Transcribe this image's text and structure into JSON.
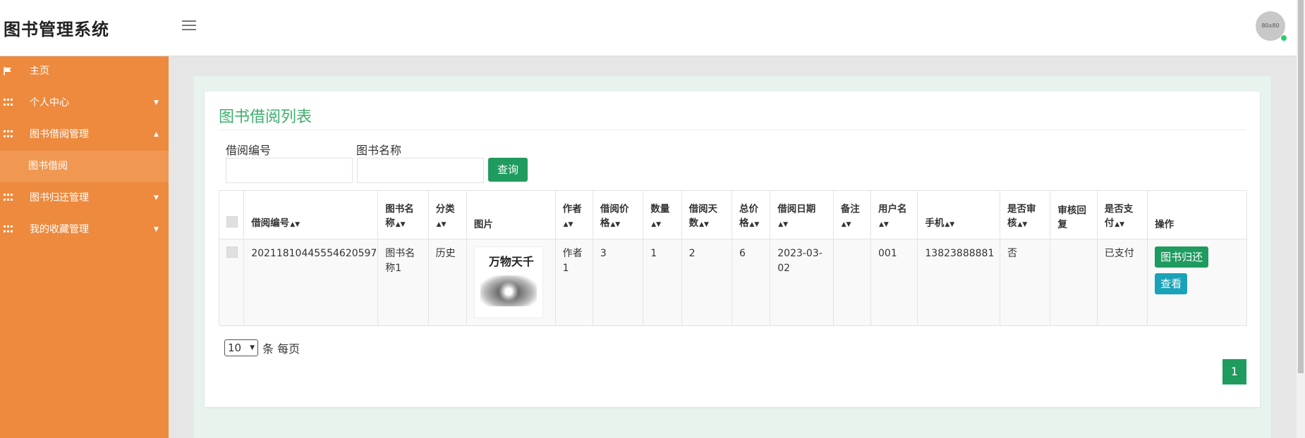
{
  "header": {
    "app_title": "图书管理系统",
    "avatar_text": "80x80"
  },
  "sidebar": {
    "items": [
      {
        "label": "主页",
        "icon": "flag-icon"
      },
      {
        "label": "个人中心",
        "icon": "grid-icon"
      },
      {
        "label": "图书借阅管理",
        "icon": "grid-icon"
      },
      {
        "label": "图书归还管理",
        "icon": "grid-icon"
      },
      {
        "label": "我的收藏管理",
        "icon": "grid-icon"
      }
    ],
    "subitem": "图书借阅"
  },
  "panel": {
    "title": "图书借阅列表",
    "search": {
      "field1_label": "借阅编号",
      "field2_label": "图书名称",
      "query_label": "查询"
    }
  },
  "table": {
    "headers": [
      "借阅编号",
      "图书名称",
      "分类",
      "图片",
      "作者",
      "借阅价格",
      "数量",
      "借阅天数",
      "总价格",
      "借阅日期",
      "备注",
      "用户名",
      "手机",
      "是否审核",
      "审核回复",
      "是否支付",
      "操作"
    ],
    "rows": [
      {
        "borrow_no": "20211810445554620597",
        "book_name": "图书名称1",
        "category": "历史",
        "cover_text": "万物天千",
        "author": "作者1",
        "price": "3",
        "quantity": "1",
        "days": "2",
        "total": "6",
        "date": "2023-03-02",
        "remark": "",
        "username": "001",
        "phone": "13823888881",
        "reviewed": "否",
        "reply": "",
        "paid": "已支付",
        "actions": [
          "图书归还",
          "查看"
        ]
      }
    ]
  },
  "pager": {
    "page_size": "10",
    "page_size_suffix": "条 每页",
    "current_page": "1"
  },
  "colors": {
    "sidebar": "#ed8a3e",
    "accent_green": "#1f9b5f",
    "title_green": "#3fae6e",
    "view_blue": "#1aa3b8"
  }
}
